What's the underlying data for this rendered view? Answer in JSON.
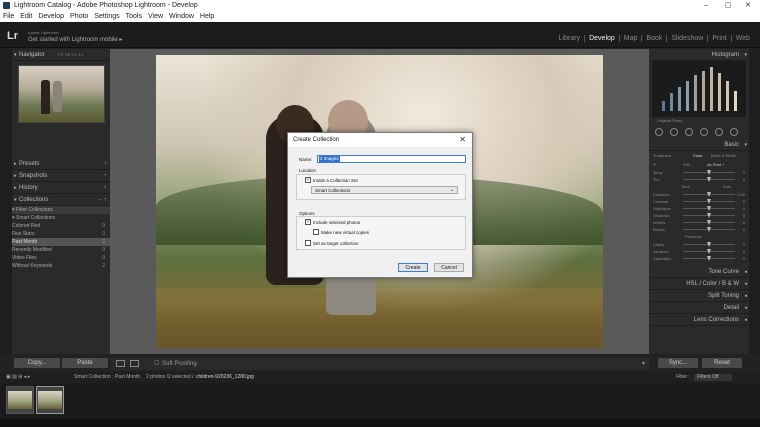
{
  "window": {
    "title": "Lightroom Catalog - Adobe Photoshop Lightroom - Develop",
    "controls": [
      "–",
      "▢",
      "✕"
    ]
  },
  "menu": [
    "File",
    "Edit",
    "Develop",
    "Photo",
    "Settings",
    "Tools",
    "View",
    "Window",
    "Help"
  ],
  "identity": {
    "logo": "Lr",
    "top_text": "Adobe Lightroom",
    "main_text": "Get started with Lightroom mobile  ▸"
  },
  "modules": [
    {
      "label": "Library",
      "active": false
    },
    {
      "label": "Develop",
      "active": true
    },
    {
      "label": "Map",
      "active": false
    },
    {
      "label": "Book",
      "active": false
    },
    {
      "label": "Slideshow",
      "active": false
    },
    {
      "label": "Print",
      "active": false
    },
    {
      "label": "Web",
      "active": false
    }
  ],
  "left": {
    "navigator": {
      "label": "Navigator",
      "opts": "FIT  Fill  1:1  3:1"
    },
    "presets": {
      "label": "Presets",
      "r": "+"
    },
    "snapshots": {
      "label": "Snapshots",
      "r": "+"
    },
    "history": {
      "label": "History",
      "r": "×"
    },
    "collections": {
      "label": "Collections",
      "r": "– +"
    },
    "tree": [
      {
        "label": "▾ Filter Collections",
        "count": ""
      },
      {
        "label": "  ▾ Smart Collections",
        "count": ""
      },
      {
        "label": "      Colored Red",
        "count": "0"
      },
      {
        "label": "      Five Stars",
        "count": "0"
      },
      {
        "label": "      Past Month",
        "count": "2"
      },
      {
        "label": "      Recently Modified",
        "count": "0"
      },
      {
        "label": "      Video Files",
        "count": "0"
      },
      {
        "label": "      Without Keywords",
        "count": "2"
      }
    ],
    "copy": "Copy...",
    "paste": "Paste"
  },
  "toolbar": {
    "soft_proofing": "Soft Proofing"
  },
  "right": {
    "histogram": "Histogram",
    "original_photo": "Original Photo",
    "basic": "Basic",
    "treatment": "Treatment :",
    "color": "Color",
    "bw": "Black & White",
    "wb": "WB :",
    "as_shot": "As Shot ÷",
    "rows_wb": [
      {
        "label": "Temp",
        "value": "0",
        "knob": 0.5
      },
      {
        "label": "Tint",
        "value": "0",
        "knob": 0.5
      }
    ],
    "tone": "Tone",
    "auto": "Auto",
    "rows_tone": [
      {
        "label": "Exposure",
        "value": "0.00",
        "knob": 0.5
      },
      {
        "label": "Contrast",
        "value": "0",
        "knob": 0.5
      },
      {
        "label": "Highlights",
        "value": "0",
        "knob": 0.5
      },
      {
        "label": "Shadows",
        "value": "0",
        "knob": 0.5
      },
      {
        "label": "Whites",
        "value": "0",
        "knob": 0.5
      },
      {
        "label": "Blacks",
        "value": "0",
        "knob": 0.5
      }
    ],
    "presence": "Presence",
    "rows_presence": [
      {
        "label": "Clarity",
        "value": "0",
        "knob": 0.5
      },
      {
        "label": "Vibrance",
        "value": "0",
        "knob": 0.5
      },
      {
        "label": "Saturation",
        "value": "0",
        "knob": 0.5
      }
    ],
    "tone_curve": "Tone Curve",
    "hsl": "HSL  /  Color  /  B & W",
    "split_toning": "Split Toning",
    "detail": "Detail",
    "lens_corrections": "Lens Corrections",
    "sync": "Sync...",
    "reset": "Reset"
  },
  "filmstrip": {
    "path": "Smart Collection : Past Month",
    "status": "2 photos /2 selected /",
    "filename": "children-920236_1280.jpg",
    "filter_label": "Filter :",
    "filter_value": "Filters Off"
  },
  "dialog": {
    "title": "Create Collection",
    "name_label": "Name:",
    "name_value": "2 Images",
    "location": "Location",
    "inside_set": "Inside a Collection Set",
    "set_value": "Smart Collections",
    "options": "Options",
    "include_selected": "Include selected photos",
    "virtual_copies": "Make new virtual copies",
    "target": "Set as target collection",
    "create": "Create",
    "cancel": "Cancel"
  },
  "colors": {
    "accent": "#3a7bd5",
    "panel": "#2a2a2a",
    "chrome": "#222222"
  }
}
